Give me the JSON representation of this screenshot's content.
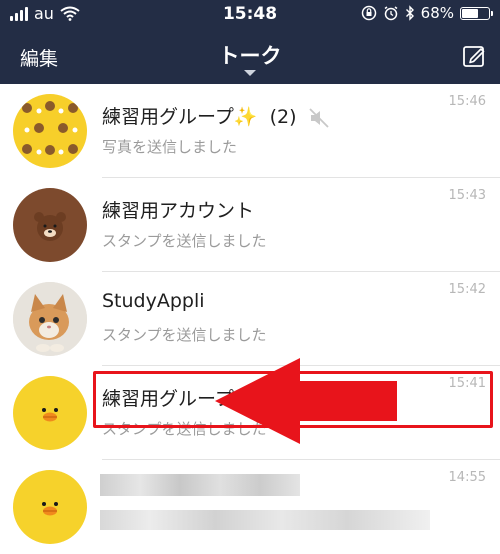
{
  "status_bar": {
    "carrier": "au",
    "time": "15:48",
    "battery": "68%",
    "battery_level": 0.68,
    "icons": [
      "signal-icon",
      "wifi-icon",
      "lock-rotation-icon",
      "alarm-icon",
      "bluetooth-icon",
      "battery-icon"
    ]
  },
  "header": {
    "edit_label": "編集",
    "title": "トーク",
    "compose_icon": "compose-icon"
  },
  "chats": [
    {
      "name": "練習用グループ✨",
      "count": "(2)",
      "muted": true,
      "message": "写真を送信しました",
      "time": "15:46"
    },
    {
      "name": "練習用アカウント",
      "message": "スタンプを送信しました",
      "time": "15:43"
    },
    {
      "name": "StudyAppli",
      "message": "スタンプを送信しました",
      "time": "15:42"
    },
    {
      "name": "練習用グループ",
      "message": "スタンプを送信しました",
      "time": "15:41"
    },
    {
      "name": "",
      "message": "",
      "time": "14:55"
    }
  ],
  "colors": {
    "header_bg": "#232d45",
    "annotation_red": "#e8141b"
  }
}
